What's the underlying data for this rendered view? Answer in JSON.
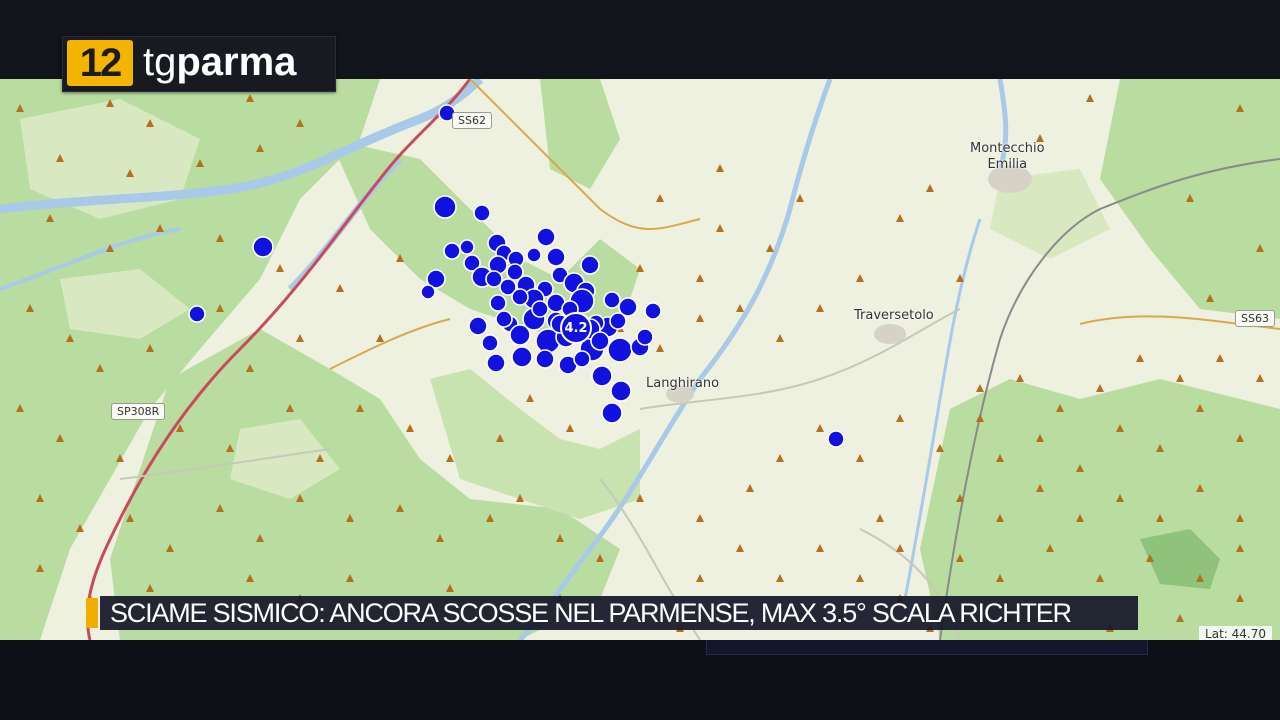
{
  "channel": {
    "logo_number": "12",
    "logo_tg": "tg",
    "logo_parma": "parma",
    "accent_color": "#f4b500"
  },
  "headline": "SCIAME SISMICO: ANCORA SCOSSE NEL PARMENSE, MAX 3.5° SCALA RICHTER",
  "map": {
    "places": [
      {
        "label": "Montecchio\nEmilia"
      },
      {
        "label": "Traversetolo"
      },
      {
        "label": "Langhirano"
      }
    ],
    "roads": [
      {
        "label": "SS62"
      },
      {
        "label": "SS63"
      },
      {
        "label": "SP308R"
      }
    ],
    "max_event_label": "4.2",
    "coordinate_readout": "Lat: 44.70",
    "event_color": "#1212e0",
    "station_color": "#b5701d"
  }
}
